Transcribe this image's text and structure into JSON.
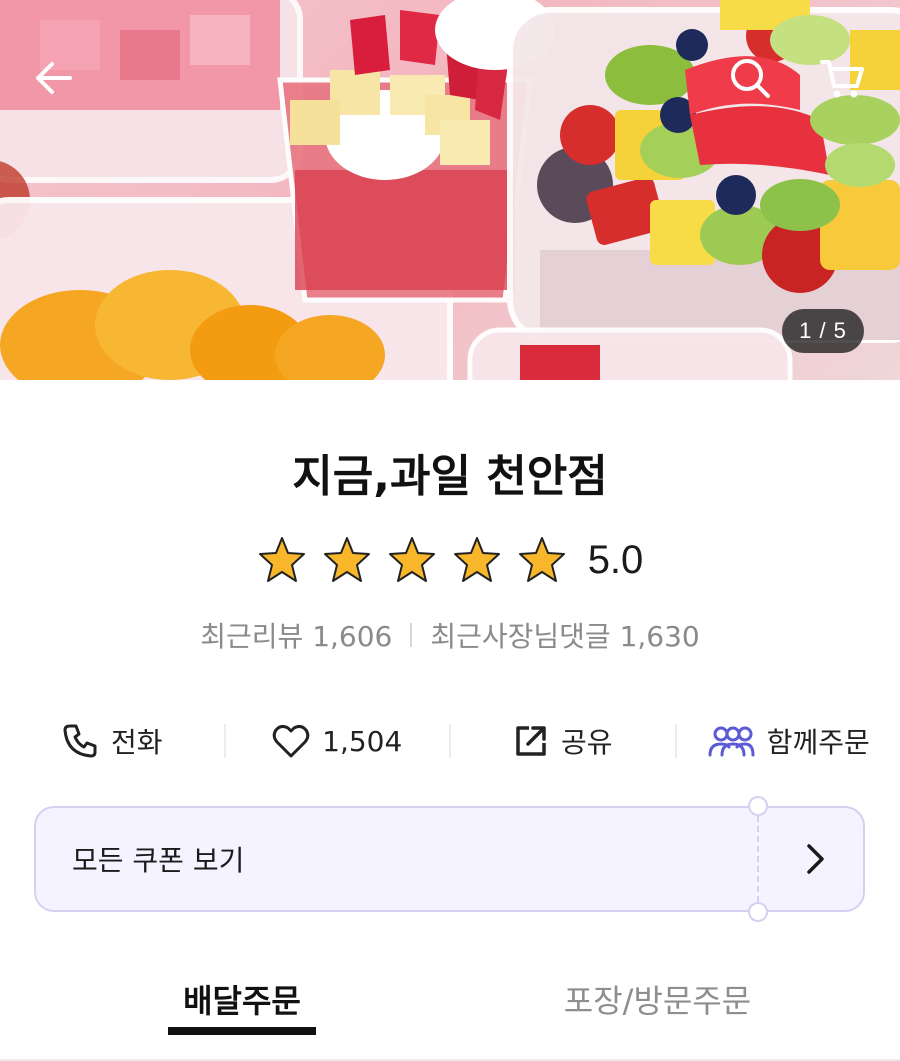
{
  "hero": {
    "image_counter": "1 / 5",
    "icons": [
      "back-arrow-icon",
      "search-icon",
      "cart-icon"
    ]
  },
  "store": {
    "name": "지금,과일 천안점",
    "rating": "5.0",
    "stars": 5,
    "recent_reviews_label": "최근리뷰 1,606",
    "recent_owner_comments_label": "최근사장님댓글 1,630"
  },
  "actions": {
    "call_label": "전화",
    "like_count": "1,504",
    "share_label": "공유",
    "group_order_label": "함께주문"
  },
  "coupon": {
    "label": "모든 쿠폰 보기"
  },
  "tabs": [
    {
      "label": "배달주문",
      "active": true
    },
    {
      "label": "포장/방문주문",
      "active": false
    }
  ],
  "colors": {
    "accent_purple": "#5b5bd6",
    "coupon_bg": "#f5f3ff",
    "coupon_border": "#d6d0f0",
    "star_gold": "#f8b72a",
    "muted_text": "#8a8a8a"
  }
}
